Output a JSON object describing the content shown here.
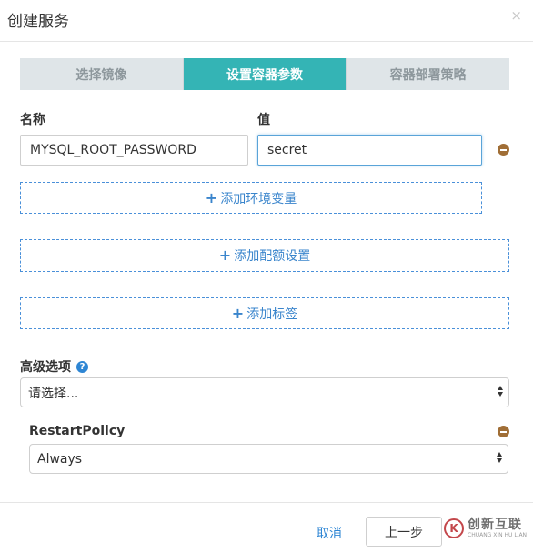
{
  "dialog": {
    "title": "创建服务",
    "close_symbol": "×"
  },
  "steps": [
    {
      "label": "选择镜像",
      "active": false
    },
    {
      "label": "设置容器参数",
      "active": true
    },
    {
      "label": "容器部署策略",
      "active": false
    }
  ],
  "env": {
    "name_header": "名称",
    "value_header": "值",
    "name_value": "MYSQL_ROOT_PASSWORD",
    "value_value": "secret"
  },
  "buttons": {
    "add_env": "添加环境变量",
    "add_quota": "添加配额设置",
    "add_label": "添加标签",
    "plus_symbol": "+"
  },
  "advanced": {
    "label": "高级选项",
    "help_symbol": "?",
    "select_value": "请选择..."
  },
  "restart_policy": {
    "label": "RestartPolicy",
    "select_value": "Always"
  },
  "footer": {
    "cancel_label": "取消",
    "prev_label": "上一步"
  },
  "watermark": {
    "logo_char": "K",
    "cn_text": "创新互联",
    "en_text": "CHUANG XIN HU LIAN"
  },
  "colors": {
    "step_active": "#34b4b5",
    "step_inactive": "#dfe5e8",
    "link_blue": "#2e86d4",
    "remove_brown": "#a06e36"
  }
}
